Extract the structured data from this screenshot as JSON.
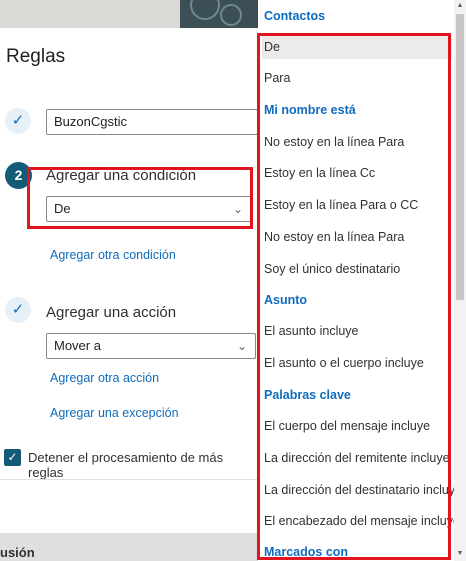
{
  "background": {
    "bottom_text": "usión"
  },
  "panel": {
    "title": "Reglas",
    "name_value": "BuzonCgstic",
    "step2_number": "2",
    "condition_label": "Agregar una condición",
    "condition_value": "De",
    "add_condition_link": "Agregar otra condición",
    "action_label": "Agregar una acción",
    "action_value": "Mover a",
    "add_action_link": "Agregar otra acción",
    "add_exception_link": "Agregar una excepción",
    "stop_processing_label": "Detener el procesamiento de más reglas",
    "stop_processing_checked": true
  },
  "dropdown_list": {
    "sections": [
      {
        "header": "Contactos"
      },
      {
        "item": "De",
        "selected": true
      },
      {
        "item": "Para"
      },
      {
        "header": "Mi nombre está"
      },
      {
        "item": "No estoy en la línea Para"
      },
      {
        "item": "Estoy en la línea Cc"
      },
      {
        "item": "Estoy en la línea Para o CC"
      },
      {
        "item": "No estoy en la línea Para"
      },
      {
        "item": "Soy el único destinatario"
      },
      {
        "header": "Asunto"
      },
      {
        "item": "El asunto incluye"
      },
      {
        "item": "El asunto o el cuerpo incluye"
      },
      {
        "header": "Palabras clave"
      },
      {
        "item": "El cuerpo del mensaje incluye"
      },
      {
        "item": "La dirección del remitente incluye"
      },
      {
        "item": "La dirección del destinatario incluye"
      },
      {
        "item": "El encabezado del mensaje incluye"
      },
      {
        "header": "Marcados con"
      }
    ]
  },
  "colors": {
    "accent": "#0f6cbd",
    "step_badge": "#135b76",
    "highlight_box": "#e0151f"
  },
  "icons": {
    "check": "check-icon",
    "chevron": "chevron-down-icon"
  }
}
